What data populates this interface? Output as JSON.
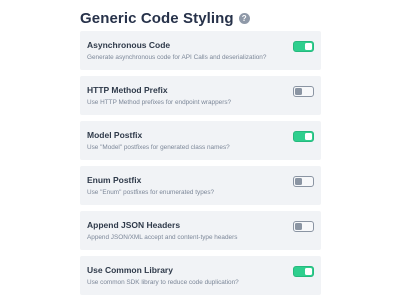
{
  "header": {
    "title": "Generic Code Styling",
    "help_icon": "question-circle-icon",
    "help_glyph": "?"
  },
  "settings": [
    {
      "title": "Asynchronous Code",
      "description": "Generate asynchronous code for API Calls and deserialization?",
      "enabled": true
    },
    {
      "title": "HTTP Method Prefix",
      "description": "Use HTTP Method prefixes for endpoint wrappers?",
      "enabled": false
    },
    {
      "title": "Model Postfix",
      "description": "Use \"Model\" postfixes for generated class names?",
      "enabled": true
    },
    {
      "title": "Enum Postfix",
      "description": "Use \"Enum\" postfixes for enumerated types?",
      "enabled": false
    },
    {
      "title": "Append JSON Headers",
      "description": "Append JSON/XML accept and content-type headers",
      "enabled": false
    },
    {
      "title": "Use Common Library",
      "description": "Use common SDK library to reduce code duplication?",
      "enabled": true
    }
  ],
  "colors": {
    "toggle_on": "#2fcf8e",
    "toggle_off_border": "#8b95a3",
    "row_background": "#f1f3f6",
    "title_text": "#27324a",
    "description_text": "#7c8798"
  }
}
